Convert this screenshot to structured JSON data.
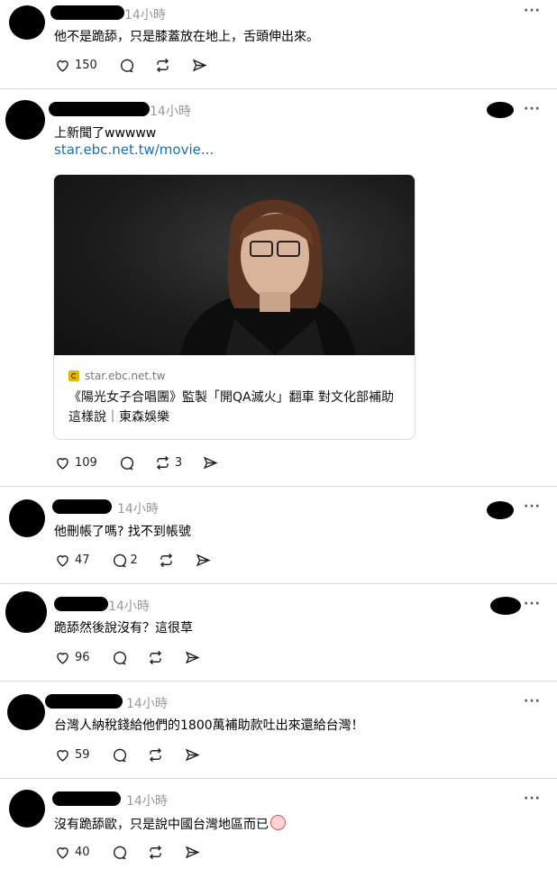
{
  "posts": [
    {
      "time": "14小時",
      "text": "他不是跪舔，只是膝蓋放在地上，舌頭伸出來。",
      "likes": "150",
      "comments": "",
      "reposts": ""
    },
    {
      "time": "14小時",
      "text": "上新聞了wwwww",
      "link": "star.ebc.net.tw/movie...",
      "card": {
        "domain": "star.ebc.net.tw",
        "title": "《陽光女子合唱團》監製「開QA滅火」翻車 對文化部補助這樣說｜東森娛樂"
      },
      "likes": "109",
      "comments": "",
      "reposts": "3"
    },
    {
      "time": "14小時",
      "text": "他刪帳了嗎? 找不到帳號",
      "likes": "47",
      "comments": "2",
      "reposts": ""
    },
    {
      "time": "14小時",
      "text": "跪舔然後說沒有？這很草",
      "likes": "96",
      "comments": "",
      "reposts": ""
    },
    {
      "time": "14小時",
      "text": "台灣人納稅錢給他們的1800萬補助款吐出來還給台灣！",
      "likes": "59",
      "comments": "",
      "reposts": ""
    },
    {
      "time": "14小時",
      "text": "沒有跪舔歐，只是說中國台灣地區而已",
      "likes": "40",
      "comments": "",
      "reposts": ""
    }
  ],
  "more_label": "···",
  "icons": [
    "heart-icon",
    "comment-icon",
    "repost-icon",
    "share-icon",
    "more-icon"
  ]
}
